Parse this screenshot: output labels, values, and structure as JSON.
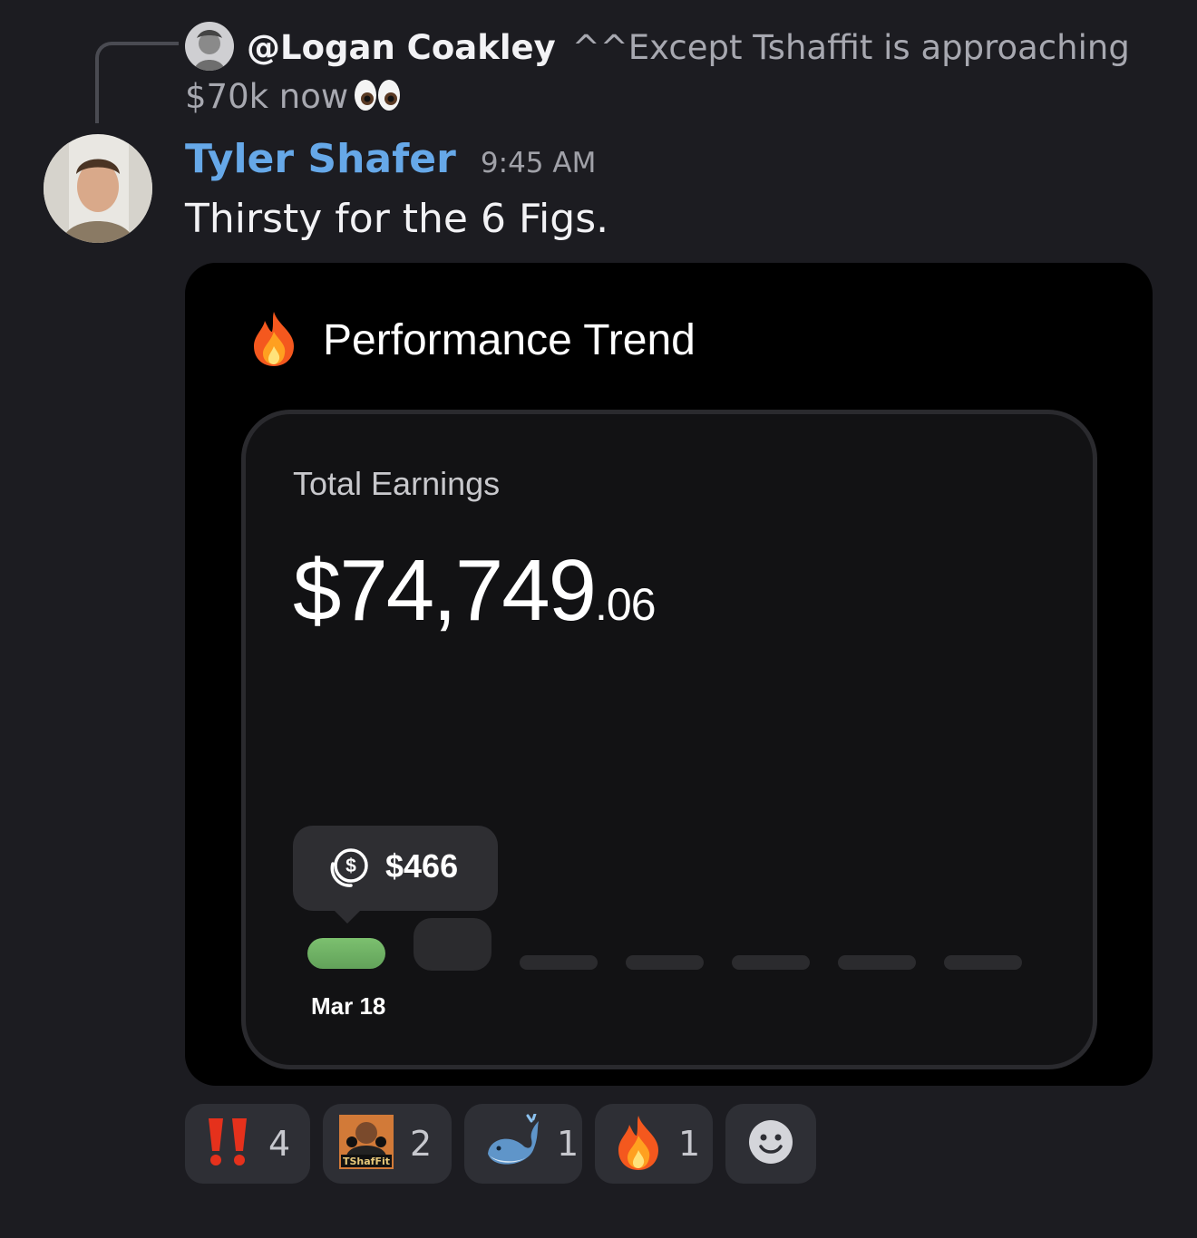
{
  "reply": {
    "author": "@Logan Coakley",
    "text": "^^Except Tshaffit is approaching $70k now",
    "avatar_icon": "user-avatar-icon",
    "emoji": "eyes-emoji"
  },
  "message": {
    "author": "Tyler Shafer",
    "timestamp": "9:45 AM",
    "text": "Thirsty for the 6 Figs.",
    "author_color": "#66a8e8"
  },
  "embed": {
    "title": "Performance Trend",
    "title_icon": "fire-emoji",
    "card_label": "Total Earnings",
    "amount_int": "$74,749",
    "amount_dec": ".06",
    "tooltip_value": "$466",
    "tooltip_icon": "coins-icon"
  },
  "chart_data": {
    "type": "bar",
    "categories": [
      "Mar 18",
      "",
      "",
      "",
      "",
      "",
      ""
    ],
    "values": [
      466,
      null,
      null,
      null,
      null,
      null,
      null
    ],
    "highlight_color": "#62a25a"
  },
  "reactions": [
    {
      "emoji": "double-exclamation-emoji",
      "count": "4"
    },
    {
      "emoji": "tshaffit-custom-emoji",
      "label": "TShafFit",
      "count": "2"
    },
    {
      "emoji": "whale-emoji",
      "count": "1"
    },
    {
      "emoji": "fire-emoji",
      "count": "1"
    },
    {
      "emoji": "add-reaction-icon",
      "count": ""
    }
  ]
}
